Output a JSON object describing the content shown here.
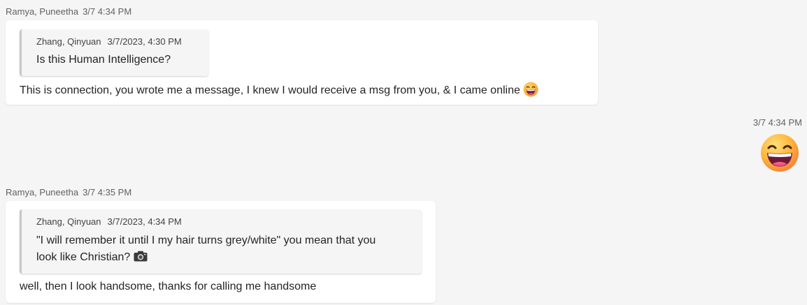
{
  "messages": [
    {
      "author": "Ramya, Puneetha",
      "time": "3/7 4:34 PM",
      "quote": {
        "author": "Zhang, Qinyuan",
        "time": "3/7/2023, 4:30 PM",
        "text": "Is this Human Intelligence?"
      },
      "body": "This is connection, you wrote me a message, I knew I would receive a msg from you, & I came online",
      "emoji": "grinning-squinting-face-icon"
    },
    {
      "time": "3/7 4:34 PM",
      "emoji": "grinning-squinting-face-icon"
    },
    {
      "author": "Ramya, Puneetha",
      "time": "3/7 4:35 PM",
      "quote": {
        "author": "Zhang, Qinyuan",
        "time": "3/7/2023, 4:34 PM",
        "text_line1": "\"I will remember it until I my hair turns grey/white\" you mean that you",
        "text_line2": "look like Christian?",
        "icon": "camera-icon"
      },
      "body": "well, then I look handsome, thanks for calling me handsome"
    }
  ],
  "colors": {
    "background": "#f5f5f5",
    "bubble": "#ffffff",
    "quote_background": "#f5f5f5",
    "meta_text": "#616161",
    "body_text": "#242424"
  }
}
